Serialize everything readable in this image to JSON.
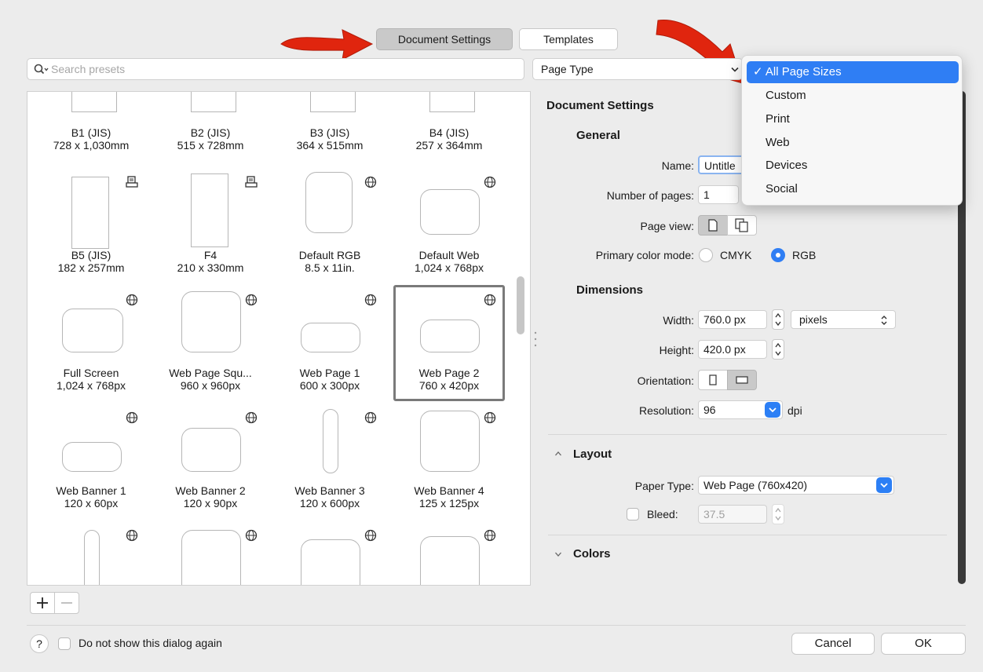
{
  "colors": {
    "accent": "#2f7ef4",
    "arrow": "#e0250e",
    "selected_border": "#7a7a7a"
  },
  "tabs": {
    "document_settings": "Document Settings",
    "templates": "Templates"
  },
  "search": {
    "placeholder": "Search presets",
    "icon": "search-icon"
  },
  "page_type": {
    "value": "Page Type"
  },
  "page_type_menu": {
    "items": [
      "All Page Sizes",
      "Custom",
      "Print",
      "Web",
      "Devices",
      "Social"
    ],
    "selected": "All Page Sizes"
  },
  "presets": [
    {
      "name": "B1 (JIS)",
      "size": "728 x 1,030mm",
      "badge": ""
    },
    {
      "name": "B2 (JIS)",
      "size": "515 x 728mm",
      "badge": ""
    },
    {
      "name": "B3 (JIS)",
      "size": "364 x 515mm",
      "badge": ""
    },
    {
      "name": "B4 (JIS)",
      "size": "257 x 364mm",
      "badge": ""
    },
    {
      "name": "B5 (JIS)",
      "size": "182 x 257mm",
      "badge": "printer-icon"
    },
    {
      "name": "F4",
      "size": "210 x 330mm",
      "badge": "printer-icon"
    },
    {
      "name": "Default RGB",
      "size": "8.5 x 11in.",
      "badge": "globe-icon"
    },
    {
      "name": "Default Web",
      "size": "1,024 x 768px",
      "badge": "globe-icon"
    },
    {
      "name": "Full Screen",
      "size": "1,024 x 768px",
      "badge": "globe-icon"
    },
    {
      "name": "Web Page Squ...",
      "size": "960 x 960px",
      "badge": "globe-icon"
    },
    {
      "name": "Web Page 1",
      "size": "600 x 300px",
      "badge": "globe-icon"
    },
    {
      "name": "Web Page 2",
      "size": "760 x 420px",
      "badge": "globe-icon",
      "selected": true
    },
    {
      "name": "Web Banner 1",
      "size": "120 x 60px",
      "badge": "globe-icon"
    },
    {
      "name": "Web Banner 2",
      "size": "120 x 90px",
      "badge": "globe-icon"
    },
    {
      "name": "Web Banner 3",
      "size": "120 x 600px",
      "badge": "globe-icon"
    },
    {
      "name": "Web Banner 4",
      "size": "125 x 125px",
      "badge": "globe-icon"
    },
    {
      "name": "",
      "size": "",
      "badge": "globe-icon"
    },
    {
      "name": "",
      "size": "",
      "badge": "globe-icon"
    },
    {
      "name": "",
      "size": "",
      "badge": "globe-icon"
    },
    {
      "name": "",
      "size": "",
      "badge": "globe-icon"
    }
  ],
  "settings": {
    "title": "Document Settings",
    "general": {
      "heading": "General",
      "name_label": "Name:",
      "name_value": "Untitle",
      "pages_label": "Number of pages:",
      "pages_value": "1",
      "view_label": "Page view:",
      "color_label": "Primary color mode:",
      "cmyk": "CMYK",
      "rgb": "RGB",
      "color_selected": "RGB"
    },
    "dimensions": {
      "heading": "Dimensions",
      "width_label": "Width:",
      "width_value": "760.0 px",
      "unit": "pixels",
      "height_label": "Height:",
      "height_value": "420.0 px",
      "orientation_label": "Orientation:",
      "resolution_label": "Resolution:",
      "resolution_value": "96",
      "dpi": "dpi"
    },
    "layout": {
      "heading": "Layout",
      "paper_label": "Paper Type:",
      "paper_value": "Web Page (760x420)",
      "bleed_label": "Bleed:",
      "bleed_value": "37.5"
    },
    "colors": {
      "heading": "Colors"
    }
  },
  "footer": {
    "dont_show": "Do not show this dialog again",
    "cancel": "Cancel",
    "ok": "OK",
    "help": "?"
  }
}
